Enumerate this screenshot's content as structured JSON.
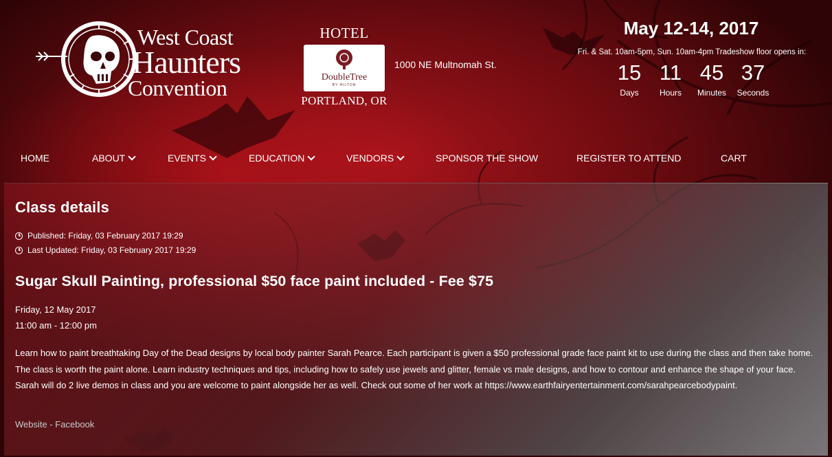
{
  "header": {
    "logo": {
      "line1": "West Coast",
      "line2": "Haunters",
      "line3": "Convention",
      "icon": "skull-compass-icon"
    },
    "hotel": {
      "top_label": "HOTEL",
      "brand": "DoubleTree",
      "brand_sub": "BY HILTON",
      "bottom_label": "PORTLAND, OR",
      "address": "1000 NE Multnomah St."
    },
    "event_date": "May 12-14, 2017",
    "hours": "Fri. & Sat. 10am-5pm, Sun. 10am-4pm Tradeshow floor opens in:",
    "countdown": [
      {
        "value": "15",
        "label": "Days"
      },
      {
        "value": "11",
        "label": "Hours"
      },
      {
        "value": "45",
        "label": "Minutes"
      },
      {
        "value": "37",
        "label": "Seconds"
      }
    ]
  },
  "nav": [
    {
      "label": "HOME",
      "dropdown": false
    },
    {
      "label": "ABOUT",
      "dropdown": true
    },
    {
      "label": "EVENTS",
      "dropdown": true
    },
    {
      "label": "EDUCATION",
      "dropdown": true
    },
    {
      "label": "VENDORS",
      "dropdown": true
    },
    {
      "label": "SPONSOR THE SHOW",
      "dropdown": false
    },
    {
      "label": "REGISTER TO ATTEND",
      "dropdown": false
    },
    {
      "label": "CART",
      "dropdown": false
    }
  ],
  "article": {
    "page_title": "Class details",
    "published": "Published: Friday, 03 February 2017 19:29",
    "updated": "Last Updated: Friday, 03 February 2017 19:29",
    "title": "Sugar Skull Painting, professional $50 face paint included - Fee $75",
    "date": "Friday, 12 May 2017",
    "time": "11:00 am - 12:00 pm",
    "description": "Learn how to paint breathtaking Day of the Dead designs by local body painter Sarah Pearce. Each participant is given a $50 professional grade face paint kit to use during the class and then take home. The class is worth the paint alone. Learn industry techniques and tips, including how to safely use jewels and glitter, female vs male designs, and how to contour and enhance the shape of your face. Sarah will do 2 live demos in class and you are welcome to paint alongside her as well. Check out some of her work at https://www.earthfairyentertainment.com/sarahpearcebodypaint.",
    "links": {
      "website": "Website",
      "separator": " - ",
      "facebook": "Facebook"
    }
  },
  "colors": {
    "background_red": "#a5141b",
    "background_dark": "#2e0406",
    "text": "#ffffff",
    "link_muted": "#c9c9c9"
  }
}
